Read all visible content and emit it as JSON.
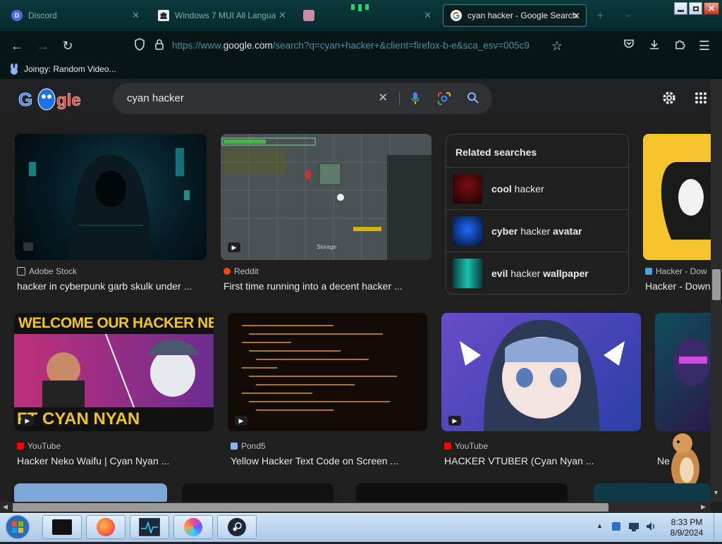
{
  "browser": {
    "tabs": [
      {
        "title": "Discord",
        "active": false
      },
      {
        "title": "Windows 7 MUI All Langua",
        "active": false
      },
      {
        "title": "",
        "active": false
      },
      {
        "title": "cyan hacker - Google Search",
        "active": true
      }
    ],
    "new_tab_label": "+",
    "url_prefix": "https://www.",
    "url_domain": "google.com",
    "url_rest": "/search?q=cyan+hacker+&client=firefox-b-e&sca_esv=005c9",
    "bookmark": "Joingy: Random Video..."
  },
  "search": {
    "query": "cyan hacker",
    "logo_text": "Google"
  },
  "results": {
    "row1": [
      {
        "source": "Adobe Stock",
        "title": "hacker in cyberpunk garb skulk under ..."
      },
      {
        "source": "Reddit",
        "title": "First time running into a decent hacker ..."
      },
      {
        "source": "Hacker - Dow",
        "title": "Hacker - Down"
      }
    ],
    "related": {
      "heading": "Related searches",
      "items": [
        {
          "bold1": "cool",
          "plain": " hacker",
          "bold2": ""
        },
        {
          "bold1": "cyber",
          "plain": " hacker ",
          "bold2": "avatar"
        },
        {
          "bold1": "evil",
          "plain": " hacker ",
          "bold2": "wallpaper"
        }
      ]
    },
    "row2": [
      {
        "source": "YouTube",
        "title": "Hacker Neko Waifu | Cyan Nyan ...",
        "thumb_top": "WELCOME OUR HACKER NEKO WAIF",
        "thumb_bottom": "FT CYAN NYAN"
      },
      {
        "source": "Pond5",
        "title": "Yellow Hacker Text Code on Screen ..."
      },
      {
        "source": "YouTube",
        "title": "HACKER VTUBER (Cyan Nyan ..."
      },
      {
        "source": "",
        "title": "Ne"
      }
    ],
    "reddit_thumb_label": "Storage"
  },
  "taskbar": {
    "time": "8:33 PM",
    "date": "8/9/2024"
  },
  "colors": {
    "accent_tab": "#2a8f93",
    "google_bg": "#202124",
    "taskbar": "#b9d3ec"
  }
}
